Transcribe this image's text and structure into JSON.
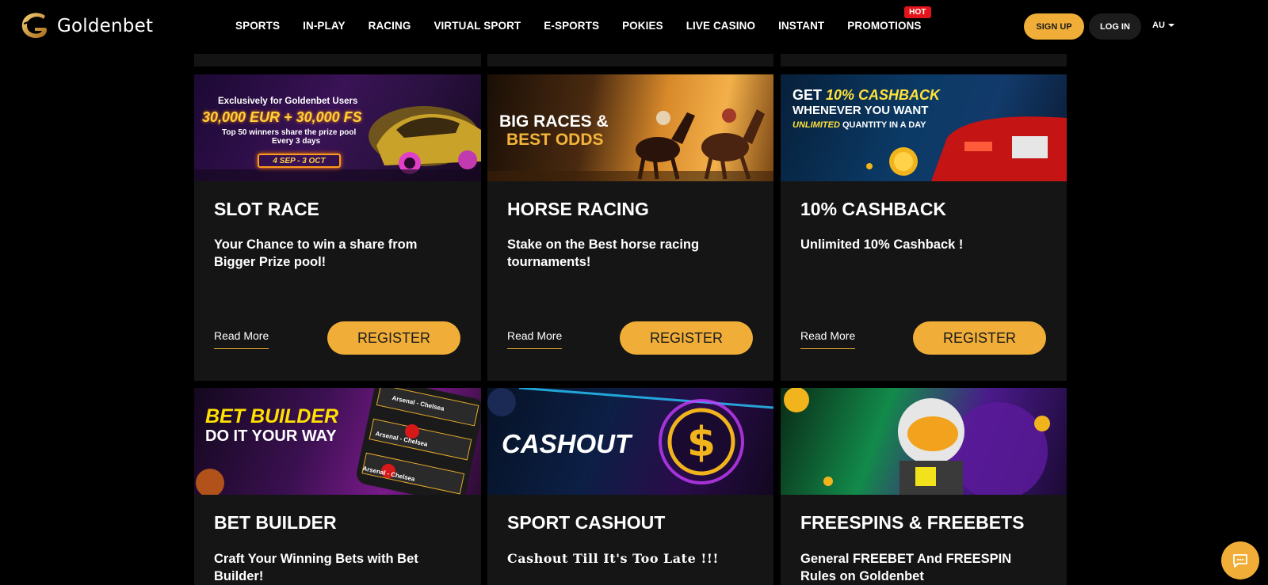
{
  "brand": {
    "name": "Goldenbet"
  },
  "nav": {
    "items": [
      "SPORTS",
      "IN-PLAY",
      "RACING",
      "VIRTUAL SPORT",
      "E-SPORTS",
      "POKIES",
      "LIVE CASINO",
      "INSTANT",
      "PROMOTIONS"
    ],
    "hot_badge": "HOT"
  },
  "header": {
    "signup_label": "SIGN UP",
    "login_label": "LOG IN",
    "lang": "AU"
  },
  "colors": {
    "accent": "#f0ae38",
    "card_bg": "#151515",
    "hot": "#e4141b"
  },
  "cards": [
    {
      "title": "SLOT RACE",
      "description": "Your Chance to win a share from Bigger Prize pool!",
      "read_more": "Read More",
      "register": "REGISTER",
      "banner": {
        "line1": "Exclusively for Goldenbet Users",
        "line2": "30,000 EUR + 30,000 FS",
        "line3": "Top 50 winners share the prize pool",
        "line4": "Every 3 days",
        "badge": "4 SEP - 3 OCT"
      }
    },
    {
      "title": "HORSE RACING",
      "description": "Stake on the Best horse racing tournaments!",
      "read_more": "Read More",
      "register": "REGISTER",
      "banner": {
        "line1": "BIG RACES &",
        "line2": "BEST ODDS"
      }
    },
    {
      "title": "10% CASHBACK",
      "description": "Unlimited 10% Cashback !",
      "read_more": "Read More",
      "register": "REGISTER",
      "banner": {
        "line1a": "GET ",
        "line1b": "10% CASHBACK",
        "line2": "WHENEVER YOU WANT",
        "line3a": "UNLIMITED",
        "line3b": " QUANTITY IN A DAY"
      }
    },
    {
      "title": "BET BUILDER",
      "description": "Craft Your Winning Bets with Bet Builder!",
      "banner": {
        "line1": "BET BUILDER",
        "line2": "DO IT YOUR WAY",
        "slip": "Arsenal - Chelsea"
      }
    },
    {
      "title": "SPORT CASHOUT",
      "description": "Cashout Till It's Too Late !!!",
      "banner": {
        "line1": "CASHOUT"
      }
    },
    {
      "title": "FREESPINS & FREEBETS",
      "description": "General FREEBET And FREESPIN Rules on Goldenbet",
      "banner": {}
    }
  ]
}
